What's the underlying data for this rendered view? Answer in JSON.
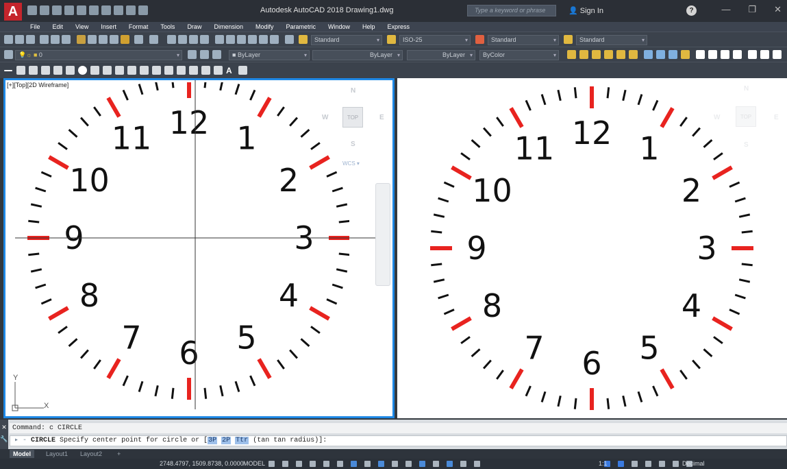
{
  "app": {
    "title": "Autodesk AutoCAD 2018   Drawing1.dwg",
    "search_placeholder": "Type a keyword or phrase",
    "sign_in": "Sign In",
    "help": "?",
    "window_controls": [
      "—",
      "❐",
      "✕"
    ]
  },
  "menu": [
    "File",
    "Edit",
    "View",
    "Insert",
    "Format",
    "Tools",
    "Draw",
    "Dimension",
    "Modify",
    "Parametric",
    "Window",
    "Help",
    "Express"
  ],
  "toolbar": {
    "text_style": "Standard",
    "dim_style": "ISO-25",
    "table_style": "Standard",
    "mleader_style": "Standard",
    "layer": "0",
    "color": "ByLayer",
    "linetype": "ByLayer",
    "lineweight": "ByLayer",
    "plotstyle": "ByColor"
  },
  "viewport_left": {
    "label": "[+][Top][2D Wireframe]",
    "viewcube": {
      "north": "N",
      "south": "S",
      "east": "E",
      "west": "W",
      "face": "TOP"
    },
    "wcs": "WCS",
    "ucs_x": "X",
    "ucs_y": "Y"
  },
  "viewport_right": {
    "viewcube": {
      "north": "N",
      "south": "S",
      "east": "E",
      "west": "W",
      "face": "TOP"
    }
  },
  "clock": {
    "numbers": [
      "12",
      "1",
      "2",
      "3",
      "4",
      "5",
      "6",
      "7",
      "8",
      "9",
      "10",
      "11"
    ],
    "hour_mark_color": "#e8231f",
    "minute_mark_color": "#111111"
  },
  "command": {
    "history": "Command: c CIRCLE",
    "prompt_prefix": "CIRCLE",
    "prompt_text": " Specify center point for circle or [",
    "options": [
      "3P",
      "2P",
      "Ttr"
    ],
    "option_tail": "(tan tan radius)]:"
  },
  "layout_tabs": [
    "Model",
    "Layout1",
    "Layout2",
    "+"
  ],
  "status": {
    "coords": "2748.4797, 1509.8738, 0.0000",
    "space": "MODEL",
    "scale": "1:1",
    "units": "Decimal"
  }
}
